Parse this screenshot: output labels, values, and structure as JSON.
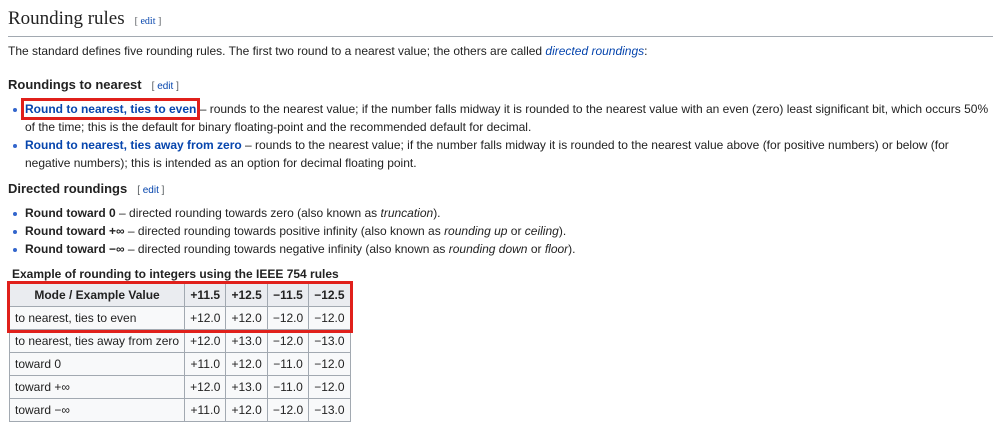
{
  "heading": {
    "title": "Rounding rules",
    "edit": "edit"
  },
  "intro": {
    "text": "The standard defines five rounding rules. The first two round to a nearest value; the others are called ",
    "link": "directed roundings",
    "end": ":"
  },
  "nearest": {
    "title": "Roundings to nearest",
    "edit": "edit",
    "items": [
      {
        "link": "Round to nearest, ties to even",
        "text": " – rounds to the nearest value; if the number falls midway it is rounded to the nearest value with an even (zero) least significant bit, which occurs 50% of the time; this is the default for binary floating-point and the recommended default for decimal."
      },
      {
        "link": "Round to nearest, ties away from zero",
        "text": " – rounds to the nearest value; if the number falls midway it is rounded to the nearest value above (for positive numbers) or below (for negative numbers); this is intended as an option for decimal floating point."
      }
    ]
  },
  "directed": {
    "title": "Directed roundings",
    "edit": "edit",
    "items": [
      {
        "bold": "Round toward 0",
        "text": " – directed rounding towards zero (also known as ",
        "em": "truncation",
        "end": ")."
      },
      {
        "bold": "Round toward +∞",
        "text": " – directed rounding towards positive infinity (also known as ",
        "em": "rounding up",
        "mid": " or ",
        "em2": "ceiling",
        "end": ")."
      },
      {
        "bold": "Round toward −∞",
        "text": " – directed rounding towards negative infinity (also known as ",
        "em": "rounding down",
        "mid": " or ",
        "em2": "floor",
        "end": ")."
      }
    ]
  },
  "table": {
    "caption": "Example of rounding to integers using the IEEE 754 rules",
    "headers": [
      "Mode / Example Value",
      "+11.5",
      "+12.5",
      "−11.5",
      "−12.5"
    ],
    "rows": [
      [
        "to nearest, ties to even",
        "+12.0",
        "+12.0",
        "−12.0",
        "−12.0"
      ],
      [
        "to nearest, ties away from zero",
        "+12.0",
        "+13.0",
        "−12.0",
        "−13.0"
      ],
      [
        "toward 0",
        "+11.0",
        "+12.0",
        "−11.0",
        "−12.0"
      ],
      [
        "toward +∞",
        "+12.0",
        "+13.0",
        "−11.0",
        "−12.0"
      ],
      [
        "toward −∞",
        "+11.0",
        "+12.0",
        "−12.0",
        "−13.0"
      ]
    ]
  },
  "colors": {
    "link": "#0645ad",
    "highlight": "#e0201b",
    "border": "#a2a9b1"
  }
}
